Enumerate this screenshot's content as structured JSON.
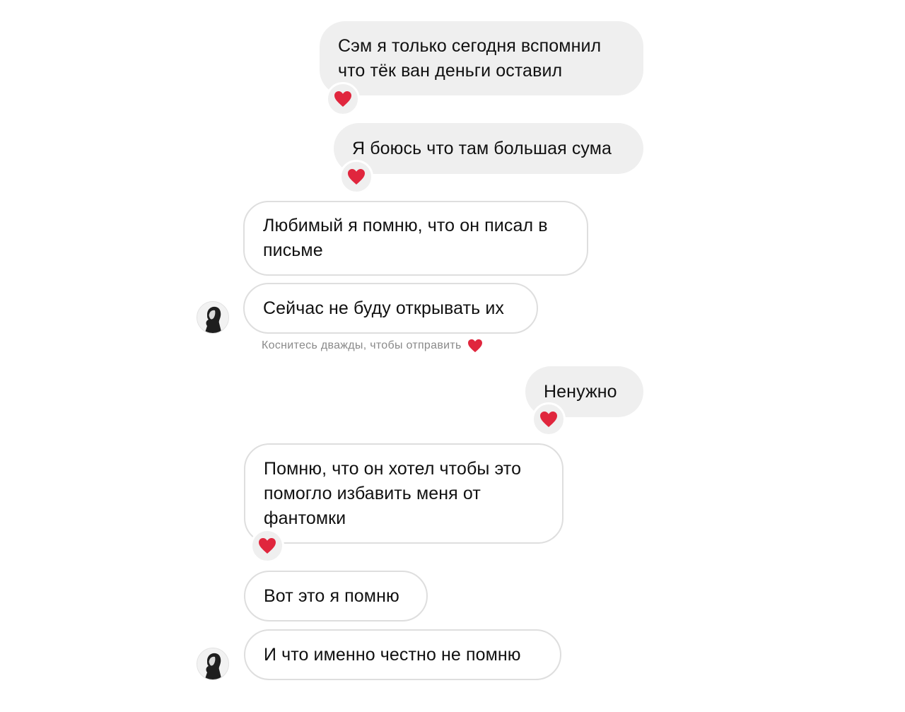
{
  "messages": [
    {
      "id": "m1",
      "direction": "outgoing",
      "text": "Сэм я только сегодня вспомнил\nчто тёк ван деньги оставил",
      "reaction": "heart"
    },
    {
      "id": "m2",
      "direction": "outgoing",
      "text": "Я боюсь что там большая сума",
      "reaction": "heart"
    },
    {
      "id": "m3",
      "direction": "incoming",
      "text": "Любимый я помню, что он писал в\nписьме"
    },
    {
      "id": "m4",
      "direction": "incoming",
      "text": "Сейчас не буду открывать их",
      "hint": "Коснитесь дважды, чтобы отправить"
    },
    {
      "id": "m5",
      "direction": "outgoing",
      "text": "Ненужно",
      "reaction": "heart"
    },
    {
      "id": "m6",
      "direction": "incoming",
      "text": "Помню, что он хотел чтобы это\nпомогло избавить меня от\nфантомки",
      "reaction": "heart"
    },
    {
      "id": "m7",
      "direction": "incoming",
      "text": "Вот это я помню"
    },
    {
      "id": "m8",
      "direction": "incoming",
      "text": "И что именно честно не помню"
    }
  ],
  "icons": {
    "reaction": "heart-icon",
    "avatar": "profile-avatar"
  },
  "colors": {
    "outgoing_bubble": "#efefef",
    "incoming_border": "#dedede",
    "heart": "#e0263d",
    "hint_text": "#8a8a8a"
  }
}
